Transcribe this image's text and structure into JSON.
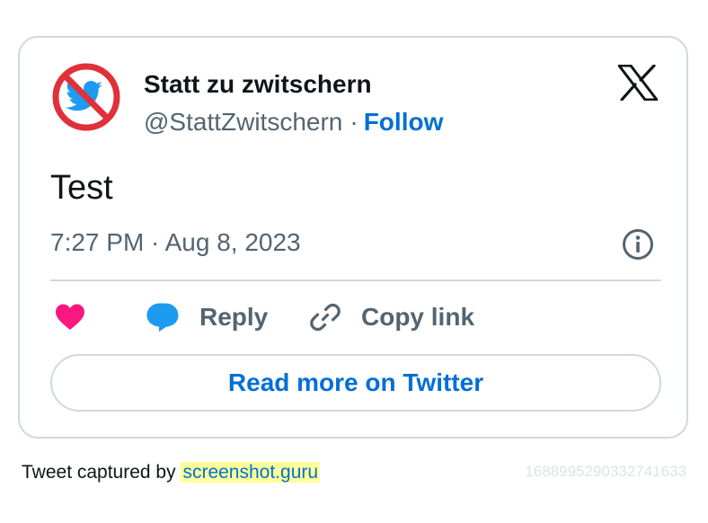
{
  "tweet": {
    "author_name": "Statt zu zwitschern",
    "handle": "@StattZwitschern",
    "separator": "·",
    "follow_label": "Follow",
    "text": "Test",
    "timestamp": "7:27 PM · Aug 8, 2023"
  },
  "actions": {
    "reply_label": "Reply",
    "copy_link_label": "Copy link",
    "read_more_label": "Read more on Twitter"
  },
  "icons": {
    "avatar": "no-bird-icon",
    "logo": "x-logo-icon",
    "info": "info-icon",
    "like": "heart-icon",
    "reply": "speech-bubble-icon",
    "copy": "link-icon"
  },
  "colors": {
    "accent_blue": "#006fd6",
    "like_pink": "#f91880",
    "reply_blue": "#1d9bf0",
    "border": "#cfd9de",
    "secondary_text": "#536471",
    "avatar_red": "#e0303a"
  },
  "footer": {
    "captured_by": "Tweet captured by",
    "link_text": "screenshot.guru",
    "id": "1688995290332741633"
  }
}
